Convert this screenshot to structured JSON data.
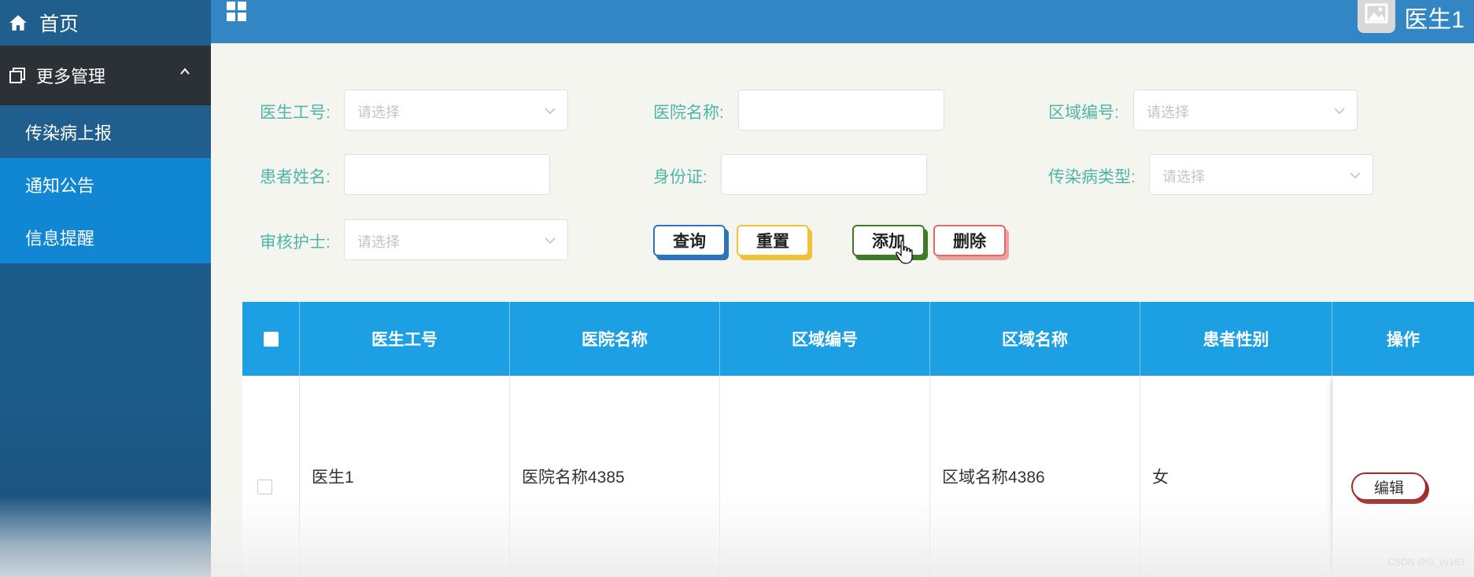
{
  "sidebar": {
    "home_label": "首页",
    "more_label": "更多管理",
    "items": [
      {
        "label": "传染病上报"
      },
      {
        "label": "通知公告"
      },
      {
        "label": "信息提醒"
      }
    ]
  },
  "topbar": {
    "user_name": "医生1"
  },
  "form": {
    "doctor_id": {
      "label": "医生工号:",
      "placeholder": "请选择"
    },
    "hospital_name": {
      "label": "医院名称:",
      "value": ""
    },
    "region_code": {
      "label": "区域编号:",
      "placeholder": "请选择"
    },
    "patient_name": {
      "label": "患者姓名:",
      "value": ""
    },
    "id_card": {
      "label": "身份证:",
      "value": ""
    },
    "disease_type": {
      "label": "传染病类型:",
      "placeholder": "请选择"
    },
    "nurse": {
      "label": "审核护士:",
      "placeholder": "请选择"
    }
  },
  "buttons": {
    "query": "查询",
    "reset": "重置",
    "add": "添加",
    "delete": "删除"
  },
  "table": {
    "columns": [
      "医生工号",
      "医院名称",
      "区域编号",
      "区域名称",
      "患者性别",
      "操作"
    ],
    "rows": [
      {
        "doctor_id": "医生1",
        "hospital_name": "医院名称4385",
        "region_code": "",
        "region_name": "区域名称4386",
        "gender": "女",
        "action": "编辑"
      }
    ]
  },
  "watermark": "CSDN @G_yy163",
  "colors": {
    "sidebar": "#1f5e8d",
    "sidebar_active": "#1187d4",
    "topbar": "#3186c3",
    "table_header": "#1da0e3",
    "label": "#4fb6a6"
  }
}
